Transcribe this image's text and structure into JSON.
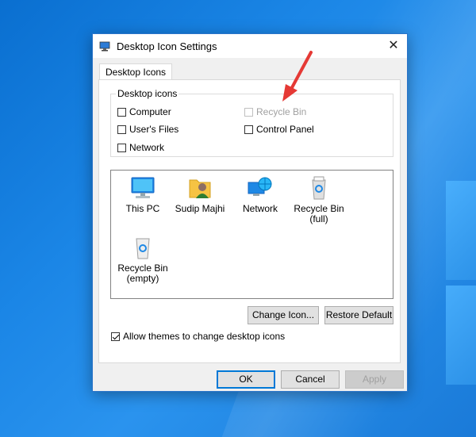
{
  "window": {
    "title": "Desktop Icon Settings",
    "close_icon": "close-icon",
    "app_icon": "desktop-settings-icon"
  },
  "tab": {
    "label": "Desktop Icons"
  },
  "group": {
    "label": "Desktop icons",
    "checkboxes": [
      {
        "label": "Computer",
        "checked": false,
        "enabled": true
      },
      {
        "label": "Recycle Bin",
        "checked": false,
        "enabled": false
      },
      {
        "label": "User's Files",
        "checked": false,
        "enabled": true
      },
      {
        "label": "Control Panel",
        "checked": false,
        "enabled": true
      },
      {
        "label": "Network",
        "checked": false,
        "enabled": true
      }
    ]
  },
  "icons": [
    {
      "label1": "This PC",
      "label2": "",
      "icon": "this-pc-icon"
    },
    {
      "label1": "Sudip Majhi",
      "label2": "",
      "icon": "user-folder-icon"
    },
    {
      "label1": "Network",
      "label2": "",
      "icon": "network-icon"
    },
    {
      "label1": "Recycle Bin",
      "label2": "(full)",
      "icon": "recycle-bin-full-icon"
    },
    {
      "label1": "Recycle Bin",
      "label2": "(empty)",
      "icon": "recycle-bin-empty-icon"
    }
  ],
  "buttons": {
    "change_icon": "Change Icon...",
    "restore_default": "Restore Default",
    "ok": "OK",
    "cancel": "Cancel",
    "apply": "Apply"
  },
  "allow_themes": {
    "label": "Allow themes to change desktop icons",
    "checked": true
  },
  "colors": {
    "accent": "#0078d7",
    "arrow": "#e53935",
    "desktop": "#1b86e6"
  }
}
